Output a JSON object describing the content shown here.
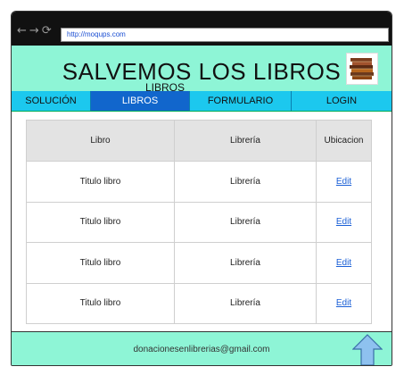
{
  "browser": {
    "url": "http://moqups.com",
    "nav_icons": [
      "back-arrow-icon",
      "forward-arrow-icon",
      "reload-icon"
    ]
  },
  "header": {
    "title": "SALVEMOS LOS LIBROS",
    "subtitle": "LIBROS",
    "logo_icon": "stack-of-books-icon"
  },
  "menu": {
    "items": [
      {
        "label": "SOLUCIÓN",
        "active": false
      },
      {
        "label": "LIBROS",
        "active": true
      },
      {
        "label": "FORMULARIO",
        "active": false
      },
      {
        "label": "LOGIN",
        "active": false
      }
    ]
  },
  "table": {
    "headers": [
      "Libro",
      "Librería",
      "Ubicacion"
    ],
    "rows": [
      [
        "Titulo libro",
        "Librería",
        "Edit"
      ],
      [
        "Titulo libro",
        "Librería",
        "Edit"
      ],
      [
        "Titulo libro",
        "Librería",
        "Edit"
      ],
      [
        "Titulo libro",
        "Librería",
        "Edit"
      ]
    ]
  },
  "footer": {
    "email": "donacionesenlibrerias@gmail.com",
    "scroll_icon": "up-arrow-icon"
  },
  "colors": {
    "header_bg": "#8ef5d6",
    "menu_bg": "#1cc8ee",
    "menu_active": "#1166cc",
    "link": "#1a5fd6"
  }
}
